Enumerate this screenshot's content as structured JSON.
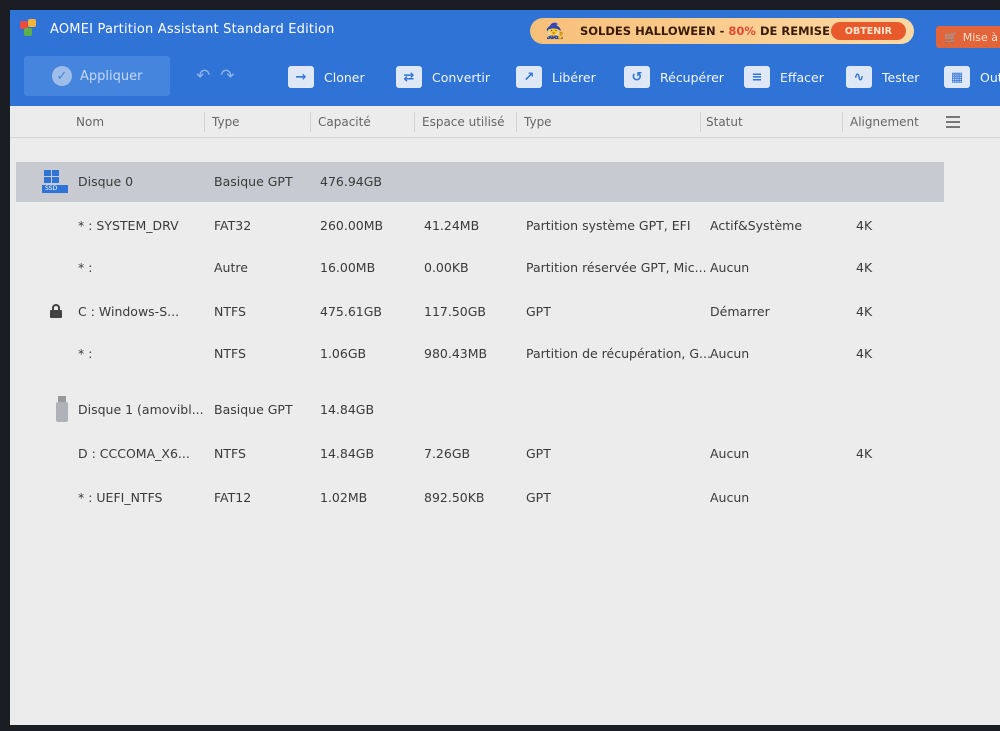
{
  "app": {
    "title": "AOMEI Partition Assistant Standard Edition"
  },
  "promo": {
    "text_before": "SOLDES HALLOWEEN - ",
    "percent": "80%",
    "text_after": " DE REMISE",
    "button": "OBTENIR"
  },
  "upgrade_label": "Mise à",
  "toolbar": {
    "apply": "Appliquer",
    "clone": "Cloner",
    "convert": "Convertir",
    "free": "Libérer",
    "recover": "Récupérer",
    "wipe": "Effacer",
    "test": "Tester",
    "tools": "Outil"
  },
  "columns": {
    "name": "Nom",
    "type": "Type",
    "capacity": "Capacité",
    "used": "Espace utilisé",
    "fs_type": "Type",
    "status": "Statut",
    "alignment": "Alignement"
  },
  "rows": [
    {
      "name": "Disque 0",
      "type": "Basique GPT",
      "capacity": "476.94GB",
      "used": "",
      "fs_type": "",
      "status": "",
      "alignment": ""
    },
    {
      "name": "* : SYSTEM_DRV",
      "type": "FAT32",
      "capacity": "260.00MB",
      "used": "41.24MB",
      "fs_type": "Partition système GPT, EFI",
      "status": "Actif&Système",
      "alignment": "4K"
    },
    {
      "name": "* :",
      "type": "Autre",
      "capacity": "16.00MB",
      "used": "0.00KB",
      "fs_type": "Partition réservée GPT, Mic...",
      "status": "Aucun",
      "alignment": "4K"
    },
    {
      "name": "C : Windows-S...",
      "type": "NTFS",
      "capacity": "475.61GB",
      "used": "117.50GB",
      "fs_type": "GPT",
      "status": "Démarrer",
      "alignment": "4K"
    },
    {
      "name": "* :",
      "type": "NTFS",
      "capacity": "1.06GB",
      "used": "980.43MB",
      "fs_type": "Partition de récupération, G...",
      "status": "Aucun",
      "alignment": "4K"
    },
    {
      "name": "Disque 1 (amovibl...",
      "type": "Basique GPT",
      "capacity": "14.84GB",
      "used": "",
      "fs_type": "",
      "status": "",
      "alignment": ""
    },
    {
      "name": "D : CCCOMA_X6...",
      "type": "NTFS",
      "capacity": "14.84GB",
      "used": "7.26GB",
      "fs_type": "GPT",
      "status": "Aucun",
      "alignment": "4K"
    },
    {
      "name": "* : UEFI_NTFS",
      "type": "FAT12",
      "capacity": "1.02MB",
      "used": "892.50KB",
      "fs_type": "GPT",
      "status": "Aucun",
      "alignment": ""
    }
  ],
  "disk_badge": "SSD",
  "colors": {
    "accent": "#2f73d6",
    "promo_bg": "#fcd9a3",
    "promo_button": "#e85a2c"
  }
}
